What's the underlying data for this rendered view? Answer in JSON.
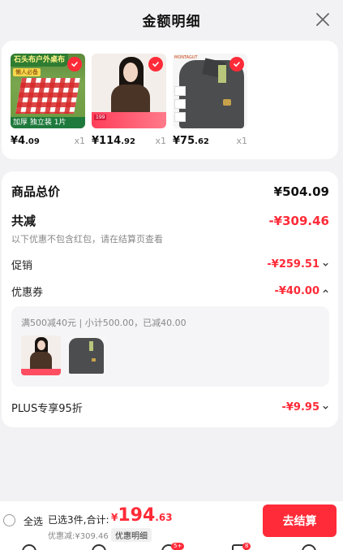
{
  "header": {
    "title": "金额明细"
  },
  "products": [
    {
      "banner": "石头布户外桌布",
      "tag": "懒人必备",
      "footer_text": "加厚 独立装 1片",
      "currency": "¥",
      "price_int": "4",
      "price_dec": ".09",
      "qty": "x1"
    },
    {
      "promo_tag": "199",
      "currency": "¥",
      "price_int": "114",
      "price_dec": ".92",
      "qty": "x1"
    },
    {
      "brand": "MONTAGUT",
      "currency": "¥",
      "price_int": "75",
      "price_dec": ".62",
      "qty": "x1"
    }
  ],
  "summary": {
    "total_label": "商品总价",
    "total_value": "¥504.09",
    "discount_label": "共减",
    "discount_value": "-¥309.46",
    "discount_note": "以下优惠不包含红包，请在结算页查看",
    "promo_label": "促销",
    "promo_value": "-¥259.51",
    "coupon_label": "优惠券",
    "coupon_value": "-¥40.00",
    "coupon_desc": "满500减40元 | 小计500.00，已减40.00",
    "plus_label": "PLUS专享95折",
    "plus_value": "-¥9.95"
  },
  "bottom_bar": {
    "select_all": "全选",
    "selected_info": "已选3件,合计:",
    "total_currency": "¥",
    "total_int": "194",
    "total_dec": ".63",
    "saved_text": "优惠减:¥309.46",
    "detail_link": "优惠明细",
    "checkout_button": "去结算"
  },
  "tabbar": {
    "badges": [
      "5+",
      "8"
    ]
  },
  "colors": {
    "accent": "#ff2b38",
    "background": "#f2f2f4",
    "card": "#ffffff"
  }
}
